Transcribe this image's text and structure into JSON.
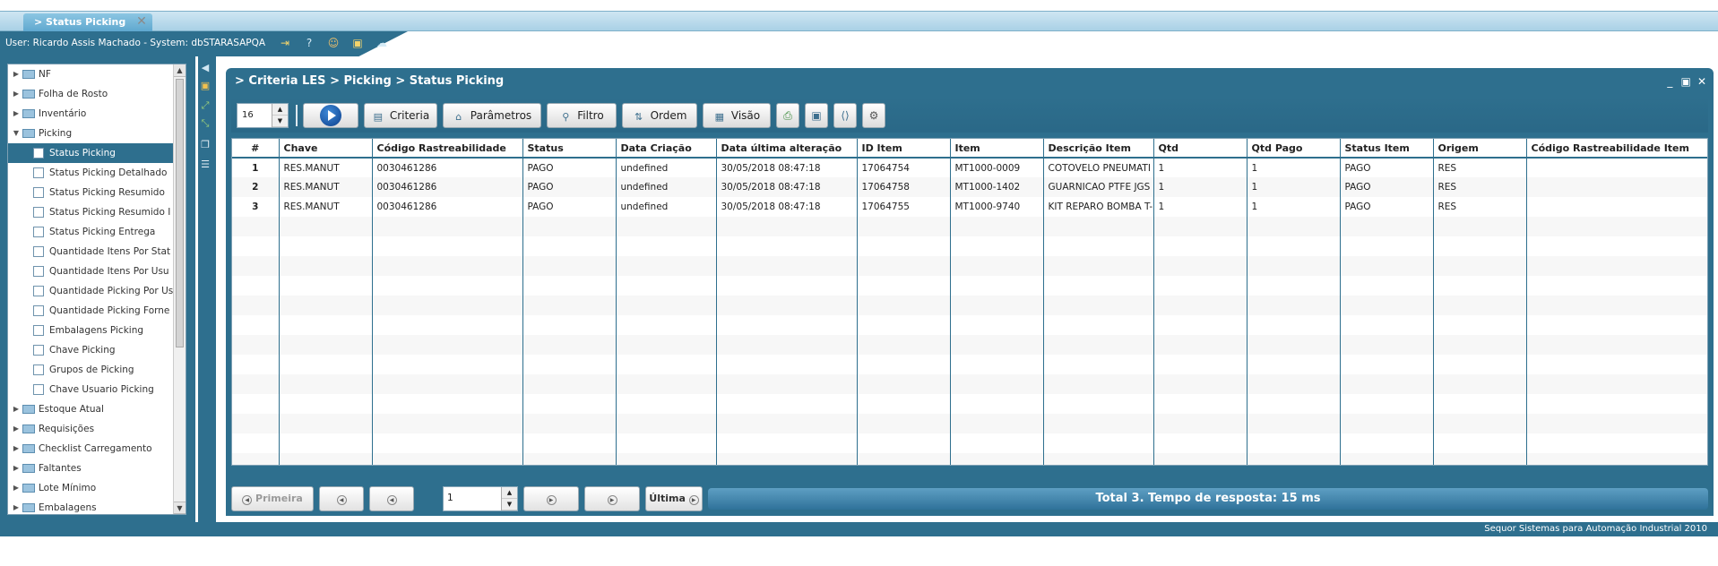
{
  "tabbar": {
    "tab_label": "> Status Picking"
  },
  "userbar": {
    "text": "User: Ricardo Assis Machado - System: dbSTARASAPQA"
  },
  "tree": {
    "items": [
      {
        "label": "NF",
        "level": 0,
        "expanded": false,
        "selected": false
      },
      {
        "label": "Folha de Rosto",
        "level": 0,
        "expanded": false,
        "selected": false
      },
      {
        "label": "Inventário",
        "level": 0,
        "expanded": false,
        "selected": false
      },
      {
        "label": "Picking",
        "level": 0,
        "expanded": true,
        "selected": false
      },
      {
        "label": "Status Picking",
        "level": 1,
        "selected": true
      },
      {
        "label": "Status Picking Detalhado",
        "level": 1,
        "selected": false
      },
      {
        "label": "Status Picking Resumido",
        "level": 1,
        "selected": false
      },
      {
        "label": "Status Picking Resumido I",
        "level": 1,
        "selected": false
      },
      {
        "label": "Status Picking Entrega",
        "level": 1,
        "selected": false
      },
      {
        "label": "Quantidade Itens Por Stat",
        "level": 1,
        "selected": false
      },
      {
        "label": "Quantidade Itens Por Usu",
        "level": 1,
        "selected": false
      },
      {
        "label": "Quantidade Picking Por Us",
        "level": 1,
        "selected": false
      },
      {
        "label": "Quantidade Picking Forne",
        "level": 1,
        "selected": false
      },
      {
        "label": "Embalagens Picking",
        "level": 1,
        "selected": false
      },
      {
        "label": "Chave Picking",
        "level": 1,
        "selected": false
      },
      {
        "label": "Grupos de Picking",
        "level": 1,
        "selected": false
      },
      {
        "label": "Chave Usuario Picking",
        "level": 1,
        "selected": false
      },
      {
        "label": "Estoque Atual",
        "level": 0,
        "expanded": false,
        "selected": false
      },
      {
        "label": "Requisições",
        "level": 0,
        "expanded": false,
        "selected": false
      },
      {
        "label": "Checklist Carregamento",
        "level": 0,
        "expanded": false,
        "selected": false
      },
      {
        "label": "Faltantes",
        "level": 0,
        "expanded": false,
        "selected": false
      },
      {
        "label": "Lote Mínimo",
        "level": 0,
        "expanded": false,
        "selected": false
      },
      {
        "label": "Embalagens",
        "level": 0,
        "expanded": false,
        "selected": false
      }
    ]
  },
  "content": {
    "title": "> Criteria LES > Picking > Status Picking",
    "window_controls": [
      "_",
      "▣",
      "✕"
    ]
  },
  "toolbar": {
    "rows_value": "16",
    "criteria_label": "Criteria",
    "parametros_label": "Parâmetros",
    "filtro_label": "Filtro",
    "ordem_label": "Ordem",
    "visao_label": "Visão"
  },
  "grid": {
    "columns": [
      "#",
      "Chave",
      "Código Rastreabilidade",
      "Status",
      "Data Criação",
      "Data última alteração",
      "ID Item",
      "Item",
      "Descrição Item",
      "Qtd",
      "Qtd Pago",
      "Status Item",
      "Origem",
      "Código Rastreabilidade Item"
    ],
    "rows": [
      [
        "1",
        "RES.MANUT",
        "0030461286",
        "PAGO",
        "undefined",
        "30/05/2018 08:47:18",
        "17064754",
        "MT1000-0009",
        "COTOVELO PNEUMATI",
        "1",
        "1",
        "PAGO",
        "RES",
        ""
      ],
      [
        "2",
        "RES.MANUT",
        "0030461286",
        "PAGO",
        "undefined",
        "30/05/2018 08:47:18",
        "17064758",
        "MT1000-1402",
        "GUARNICAO PTFE JGS",
        "1",
        "1",
        "PAGO",
        "RES",
        ""
      ],
      [
        "3",
        "RES.MANUT",
        "0030461286",
        "PAGO",
        "undefined",
        "30/05/2018 08:47:18",
        "17064755",
        "MT1000-9740",
        "KIT REPARO BOMBA T-",
        "1",
        "1",
        "PAGO",
        "RES",
        ""
      ]
    ],
    "empty_rows": 13
  },
  "pager": {
    "first_label": "Primeira",
    "last_label": "Última",
    "page_value": "1",
    "status": "Total 3. Tempo de resposta: 15 ms"
  },
  "footer": {
    "text": "Sequor Sistemas para Automação Industrial 2010"
  },
  "colors": {
    "primary": "#2e6f8e",
    "tab": "#6bb0d6"
  }
}
